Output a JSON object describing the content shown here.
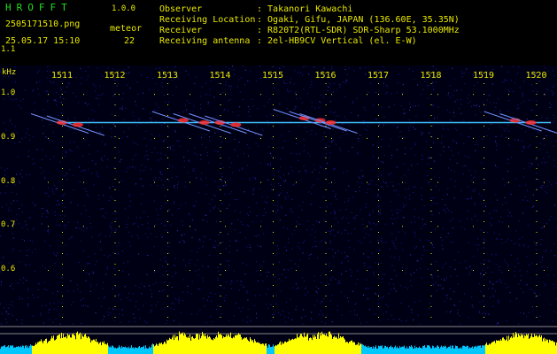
{
  "header": {
    "logo": "HROFFT",
    "version": "1.0.0",
    "filename": "2505171510.png",
    "type_label": "meteor",
    "datetime": "25.05.17 15:10",
    "count": "22",
    "info": [
      {
        "label": "Observer",
        "value": ": Takanori Kawachi"
      },
      {
        "label": "Receiving Location",
        "value": ": Ogaki, Gifu, JAPAN (136.60E, 35.35N)"
      },
      {
        "label": "Receiver",
        "value": ": R820T2(RTL-SDR) SDR-Sharp 53.1000MHz"
      },
      {
        "label": "Receiving antenna",
        "value": ": 2el-HB9CV Vertical (el. E-W)"
      }
    ]
  },
  "axes": {
    "y_unit": "kHz",
    "y_ticks": [
      "1.1",
      "1.0",
      "0.9",
      "0.8",
      "0.7",
      "0.6"
    ],
    "x_ticks": [
      "1511",
      "1512",
      "1513",
      "1514",
      "1515",
      "1516",
      "1517",
      "1518",
      "1519",
      "1520"
    ]
  },
  "colors": {
    "text": "#e8e800",
    "logo": "#22dd22",
    "background": "#000014",
    "noise": "#1a1a9a",
    "signal": "#40c0ff",
    "meteor": "#ff3030",
    "level_base": "#00c8ff",
    "level_peak": "#ffff00"
  },
  "chart_data": {
    "type": "heatmap",
    "x_range_min": [
      1510.8,
      1520.0
    ],
    "y_range_khz": [
      0.58,
      1.17
    ],
    "carrier_khz": 0.935,
    "meteors": [
      {
        "t_min": 1511.0,
        "f_khz": 0.935
      },
      {
        "t_min": 1511.3,
        "f_khz": 0.93
      },
      {
        "t_min": 1513.3,
        "f_khz": 0.94
      },
      {
        "t_min": 1513.7,
        "f_khz": 0.935
      },
      {
        "t_min": 1514.0,
        "f_khz": 0.935
      },
      {
        "t_min": 1514.3,
        "f_khz": 0.93
      },
      {
        "t_min": 1515.6,
        "f_khz": 0.945
      },
      {
        "t_min": 1515.9,
        "f_khz": 0.94
      },
      {
        "t_min": 1516.1,
        "f_khz": 0.935
      },
      {
        "t_min": 1519.6,
        "f_khz": 0.94
      },
      {
        "t_min": 1519.9,
        "f_khz": 0.935
      }
    ]
  }
}
